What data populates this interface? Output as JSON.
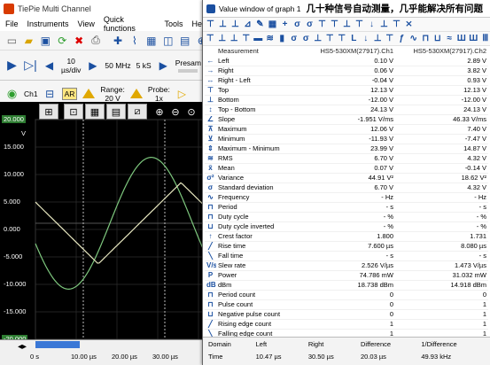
{
  "main_window": {
    "title": "TiePie Multi Channel",
    "menu": [
      "File",
      "Instruments",
      "View",
      "Quick functions",
      "Tools",
      "Help"
    ],
    "timebase": {
      "value": "10",
      "unit": "µs/div"
    },
    "samplerate": "50 MHz",
    "record_length": "5 kS",
    "presample_label": "Presam",
    "channel": {
      "name": "Ch1",
      "mode": "AR",
      "range_label": "Range:",
      "range_value": "20 V",
      "probe_label": "Probe:",
      "probe_value": "1x"
    },
    "graph": {
      "y_unit": "V",
      "y_ticks": [
        "20.000",
        "15.000",
        "10.000",
        "5.000",
        "0.000",
        "-5.000",
        "-10.000",
        "-15.000",
        "-20.000"
      ],
      "x_ticks": [
        "0 s",
        "10.00 µs",
        "20.00 µs",
        "30.00 µs"
      ],
      "ch1_color": "#7ec87e",
      "ch2_color": "#e8e8c0"
    }
  },
  "value_window": {
    "title": "Value window of graph 1",
    "annotation": "几十种信号自动测量，几乎能解决所有问题",
    "header": {
      "measurement": "Measurement",
      "col1": "HS5-530XM(27917).Ch1",
      "col2": "HS5-530XM(27917).Ch2"
    },
    "rows": [
      {
        "icon": "←",
        "label": "Left",
        "ch1": "0.10 V",
        "ch2": "2.89 V"
      },
      {
        "icon": "→",
        "label": "Right",
        "ch1": "0.06 V",
        "ch2": "3.82 V"
      },
      {
        "icon": "↔",
        "label": "Right - Left",
        "ch1": "-0.04 V",
        "ch2": "0.93 V"
      },
      {
        "icon": "⊤",
        "label": "Top",
        "ch1": "12.13 V",
        "ch2": "12.13 V"
      },
      {
        "icon": "⊥",
        "label": "Bottom",
        "ch1": "-12.00 V",
        "ch2": "-12.00 V"
      },
      {
        "icon": "↕",
        "label": "Top - Bottom",
        "ch1": "24.13 V",
        "ch2": "24.13 V"
      },
      {
        "icon": "∠",
        "label": "Slope",
        "ch1": "-1.951 V/ms",
        "ch2": "46.33 V/ms"
      },
      {
        "icon": "⊼",
        "label": "Maximum",
        "ch1": "12.06 V",
        "ch2": "7.40 V"
      },
      {
        "icon": "⊻",
        "label": "Minimum",
        "ch1": "-11.93 V",
        "ch2": "-7.47 V"
      },
      {
        "icon": "⇕",
        "label": "Maximum - Minimum",
        "ch1": "23.99 V",
        "ch2": "14.87 V"
      },
      {
        "icon": "≋",
        "label": "RMS",
        "ch1": "6.70 V",
        "ch2": "4.32 V"
      },
      {
        "icon": "x̄",
        "label": "Mean",
        "ch1": "0.07 V",
        "ch2": "-0.14 V"
      },
      {
        "icon": "σ²",
        "label": "Variance",
        "ch1": "44.91 V²",
        "ch2": "18.62 V²"
      },
      {
        "icon": "σ",
        "label": "Standard deviation",
        "ch1": "6.70 V",
        "ch2": "4.32 V"
      },
      {
        "icon": "∿",
        "label": "Frequency",
        "ch1": "- Hz",
        "ch2": "- Hz"
      },
      {
        "icon": "⊓",
        "label": "Period",
        "ch1": "- s",
        "ch2": "- s"
      },
      {
        "icon": "⊓",
        "label": "Duty cycle",
        "ch1": "- %",
        "ch2": "- %"
      },
      {
        "icon": "⊔",
        "label": "Duty cycle inverted",
        "ch1": "- %",
        "ch2": "- %"
      },
      {
        "icon": "↑",
        "label": "Crest factor",
        "ch1": "1.800",
        "ch2": "1.731"
      },
      {
        "icon": "╱",
        "label": "Rise time",
        "ch1": "7.600 µs",
        "ch2": "8.080 µs"
      },
      {
        "icon": "╲",
        "label": "Fall time",
        "ch1": "- s",
        "ch2": "- s"
      },
      {
        "icon": "V/s",
        "label": "Slew rate",
        "ch1": "2.526 V/µs",
        "ch2": "1.473 V/µs"
      },
      {
        "icon": "P",
        "label": "Power",
        "ch1": "74.786 mW",
        "ch2": "31.032 mW"
      },
      {
        "icon": "dB",
        "label": "dBm",
        "ch1": "18.738 dBm",
        "ch2": "14.918 dBm"
      },
      {
        "icon": "⊓",
        "label": "Period count",
        "ch1": "0",
        "ch2": "0"
      },
      {
        "icon": "⊓",
        "label": "Pulse count",
        "ch1": "0",
        "ch2": "1"
      },
      {
        "icon": "⊔",
        "label": "Negative pulse count",
        "ch1": "0",
        "ch2": "1"
      },
      {
        "icon": "╱",
        "label": "Rising edge count",
        "ch1": "1",
        "ch2": "1"
      },
      {
        "icon": "╲",
        "label": "Falling edge count",
        "ch1": "1",
        "ch2": "1"
      }
    ],
    "cursor_panel": {
      "headers": [
        "Domain",
        "Left",
        "Right",
        "Difference",
        "1/Difference"
      ],
      "values": [
        "Time",
        "10.47 µs",
        "30.50 µs",
        "20.03 µs",
        "49.93 kHz"
      ]
    }
  }
}
